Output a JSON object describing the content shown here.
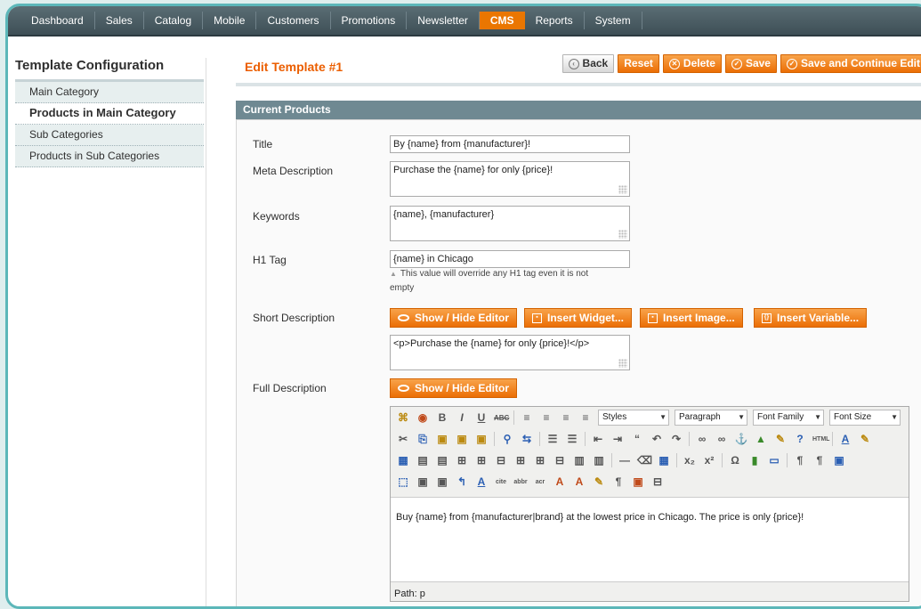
{
  "nav": {
    "items": [
      "Dashboard",
      "Sales",
      "Catalog",
      "Mobile",
      "Customers",
      "Promotions",
      "Newsletter",
      "CMS",
      "Reports",
      "System"
    ],
    "active": "CMS"
  },
  "sidebar": {
    "title": "Template Configuration",
    "items": [
      {
        "label": "Main Category"
      },
      {
        "label": "Products in Main Category"
      },
      {
        "label": "Sub Categories"
      },
      {
        "label": "Products in Sub Categories"
      }
    ],
    "active": "Products in Main Category"
  },
  "page": {
    "title": "Edit Template #1",
    "buttons": {
      "back": "Back",
      "reset": "Reset",
      "delete": "Delete",
      "save": "Save",
      "save_continue": "Save and Continue Edit"
    },
    "section_title": "Current Products"
  },
  "form": {
    "title": {
      "label": "Title",
      "value": "By {name} from {manufacturer}!"
    },
    "meta_description": {
      "label": "Meta Description",
      "value": "Purchase the {name} for only {price}!"
    },
    "keywords": {
      "label": "Keywords",
      "value": "{name}, {manufacturer}"
    },
    "h1_tag": {
      "label": "H1 Tag",
      "value": "{name} in Chicago",
      "note_line1": "This value will override any H1 tag even it is not",
      "note_line2": "empty"
    },
    "short_description": {
      "label": "Short Description",
      "value": "<p>Purchase the {name} for only {price}!</p>",
      "buttons": {
        "show_hide": "Show / Hide Editor",
        "insert_widget": "Insert Widget...",
        "insert_image": "Insert Image...",
        "insert_variable": "Insert Variable..."
      }
    },
    "full_description": {
      "label": "Full Description",
      "show_hide": "Show / Hide Editor",
      "editor": {
        "styles": "Styles",
        "format": "Paragraph",
        "font_family": "Font Family",
        "font_size": "Font Size",
        "content": "Buy {name} from {manufacturer|brand} at the lowest price in Chicago. The price is only {price}!",
        "path": "Path: p"
      }
    }
  },
  "colors": {
    "accent": "#eb6e05",
    "nav_bg": "#4a5d64",
    "section_head": "#6f8992",
    "frame": "#5cb7b9"
  }
}
